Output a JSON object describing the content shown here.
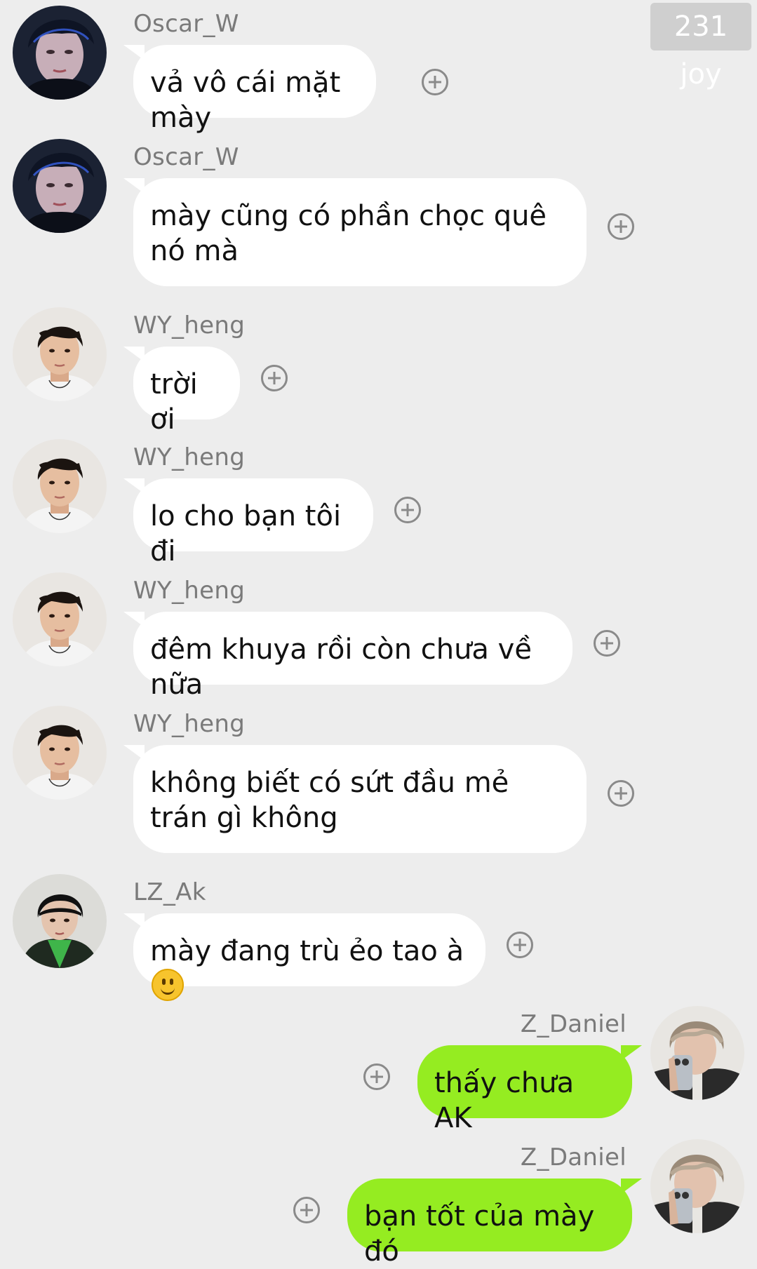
{
  "watermark": "231 joy",
  "messages": [
    {
      "sender": "Oscar_W",
      "text": "vả vô cái mặt mày",
      "side": "left",
      "avatar": "oscar"
    },
    {
      "sender": "Oscar_W",
      "text": "mày cũng có phần chọc quê nó mà",
      "side": "left",
      "avatar": "oscar"
    },
    {
      "sender": "WY_heng",
      "text": "trời ơi",
      "side": "left",
      "avatar": "wy"
    },
    {
      "sender": "WY_heng",
      "text": "lo cho bạn tôi đi",
      "side": "left",
      "avatar": "wy"
    },
    {
      "sender": "WY_heng",
      "text": "đêm khuya rồi còn chưa về nữa",
      "side": "left",
      "avatar": "wy"
    },
    {
      "sender": "WY_heng",
      "text": "không biết có sứt đầu mẻ trán gì không",
      "side": "left",
      "avatar": "wy"
    },
    {
      "sender": "LZ_Ak",
      "text": "mày đang trù ẻo tao à",
      "emoji": "slightly-smiling-face",
      "side": "left",
      "avatar": "lz"
    },
    {
      "sender": "Z_Daniel",
      "text": "thấy chưa AK",
      "side": "right",
      "avatar": "daniel"
    },
    {
      "sender": "Z_Daniel",
      "text": "bạn tốt của mày đó",
      "side": "right",
      "avatar": "daniel"
    }
  ],
  "colors": {
    "background": "#ededed",
    "incoming_bubble": "#ffffff",
    "outgoing_bubble": "#95ec21",
    "name_text": "#7a7a7a"
  },
  "icons": {
    "reaction": "plus-circle-icon",
    "emoji": "slightly-smiling-face"
  }
}
